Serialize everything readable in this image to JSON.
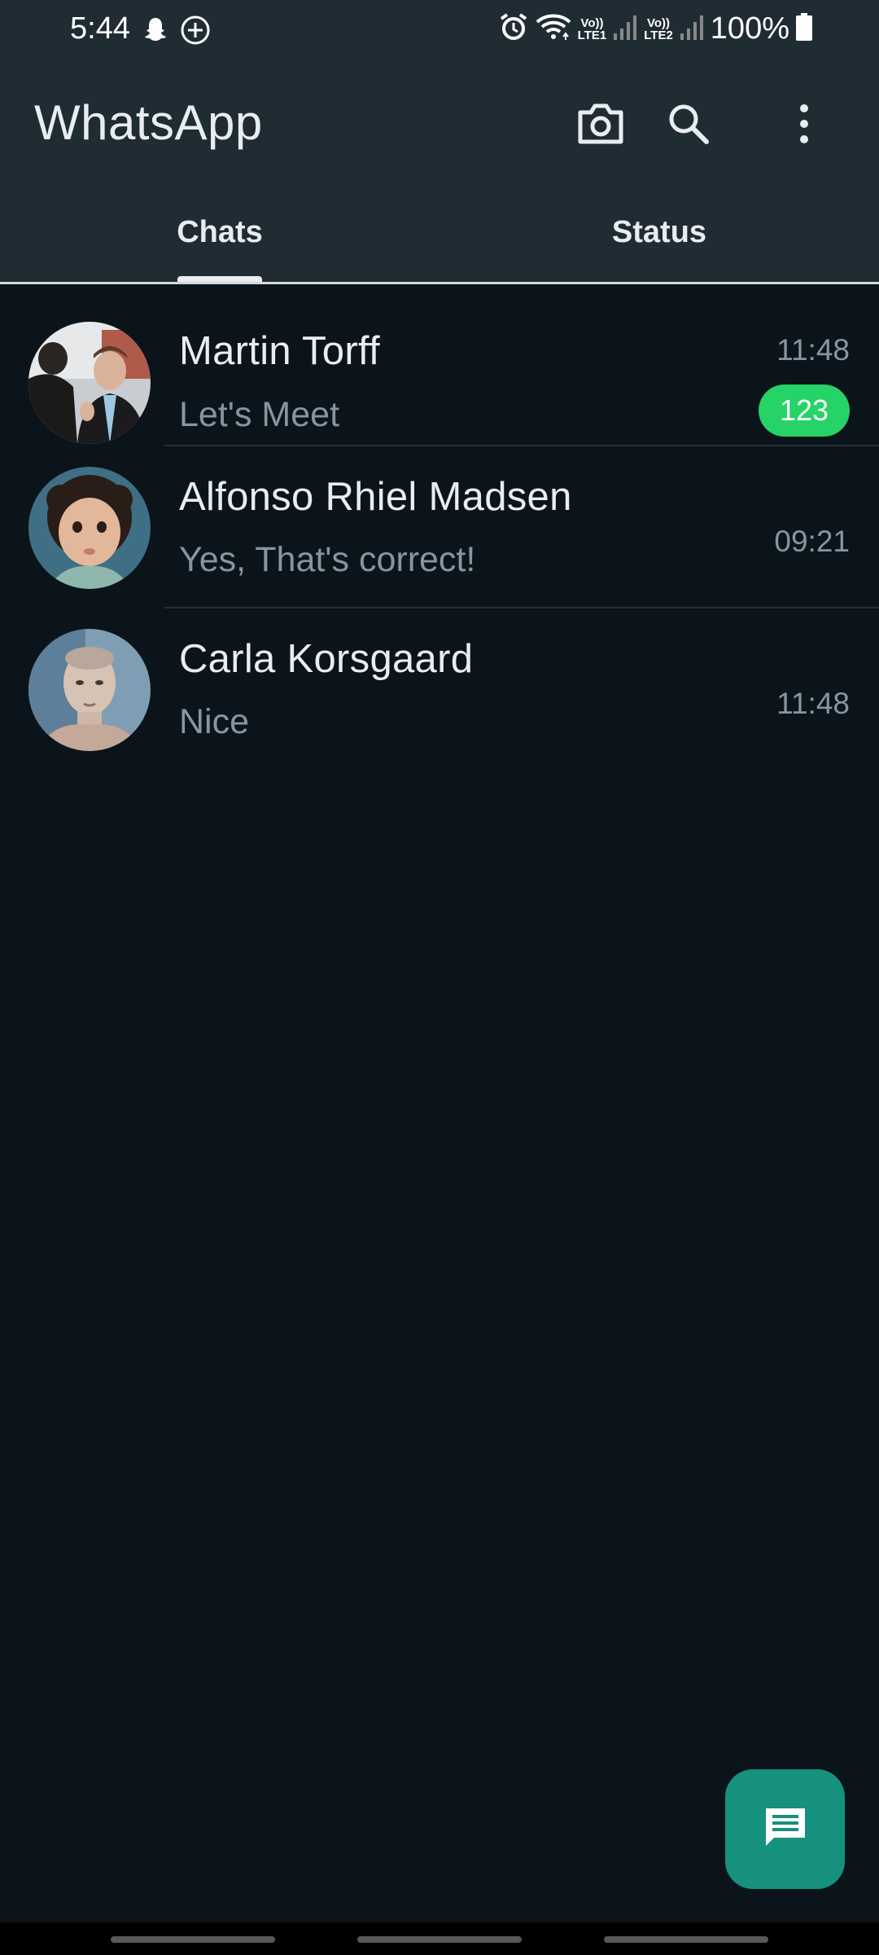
{
  "status_bar": {
    "time": "5:44",
    "sim1": {
      "top": "Vo))",
      "bottom": "LTE1"
    },
    "sim2": {
      "top": "Vo))",
      "bottom": "LTE2"
    },
    "battery": "100%"
  },
  "app_bar": {
    "title": "WhatsApp",
    "icons": [
      "camera-icon",
      "search-icon",
      "more-vertical-icon"
    ]
  },
  "tabs": [
    {
      "label": "Chats",
      "selected": true
    },
    {
      "label": "Status",
      "selected": false
    }
  ],
  "chats": [
    {
      "name": "Martin Torff",
      "message": "Let's Meet",
      "time": "11:48",
      "unread": "123"
    },
    {
      "name": "Alfonso Rhiel Madsen",
      "message": "Yes, That's correct!",
      "time": "09:21"
    },
    {
      "name": "Carla Korsgaard",
      "message": "Nice",
      "time": "11:48"
    }
  ],
  "fab": {
    "icon": "new-chat-icon"
  },
  "colors": {
    "background": "#0b141a",
    "header": "#1f2c34",
    "unread_badge": "#25d366",
    "fab": "#15917d",
    "secondary_text": "#8696a0"
  }
}
